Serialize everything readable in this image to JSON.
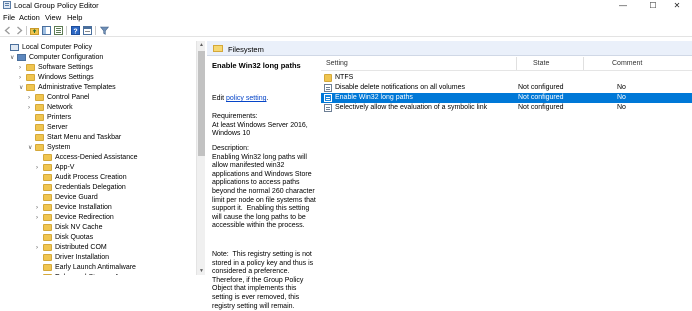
{
  "window": {
    "title": "Local Group Policy Editor",
    "minimize": "—",
    "maximize": "☐",
    "close": "✕"
  },
  "menu": [
    "File",
    "Action",
    "View",
    "Help"
  ],
  "toolbar": [
    "back-icon",
    "forward-icon",
    "folder-up-icon",
    "show-hide-tree-icon",
    "export-list-icon",
    "help-icon",
    "properties-icon",
    "filter-icon"
  ],
  "tree": [
    {
      "label": "Local Computer Policy",
      "level": 0,
      "expander": "",
      "icon": "computer-policy-icon"
    },
    {
      "label": "Computer Configuration",
      "level": 1,
      "expander": "∨",
      "icon": "computer-icon"
    },
    {
      "label": "Software Settings",
      "level": 2,
      "expander": "›",
      "icon": "folder-icon"
    },
    {
      "label": "Windows Settings",
      "level": 2,
      "expander": "›",
      "icon": "folder-icon"
    },
    {
      "label": "Administrative Templates",
      "level": 2,
      "expander": "∨",
      "icon": "folder-icon"
    },
    {
      "label": "Control Panel",
      "level": 3,
      "expander": "›",
      "icon": "folder-icon"
    },
    {
      "label": "Network",
      "level": 3,
      "expander": "›",
      "icon": "folder-icon"
    },
    {
      "label": "Printers",
      "level": 3,
      "expander": "",
      "icon": "folder-icon"
    },
    {
      "label": "Server",
      "level": 3,
      "expander": "",
      "icon": "folder-icon"
    },
    {
      "label": "Start Menu and Taskbar",
      "level": 3,
      "expander": "",
      "icon": "folder-icon"
    },
    {
      "label": "System",
      "level": 3,
      "expander": "∨",
      "icon": "folder-icon"
    },
    {
      "label": "Access-Denied Assistance",
      "level": 4,
      "expander": "",
      "icon": "folder-icon"
    },
    {
      "label": "App-V",
      "level": 4,
      "expander": "›",
      "icon": "folder-icon"
    },
    {
      "label": "Audit Process Creation",
      "level": 4,
      "expander": "",
      "icon": "folder-icon"
    },
    {
      "label": "Credentials Delegation",
      "level": 4,
      "expander": "",
      "icon": "folder-icon"
    },
    {
      "label": "Device Guard",
      "level": 4,
      "expander": "",
      "icon": "folder-icon"
    },
    {
      "label": "Device Installation",
      "level": 4,
      "expander": "›",
      "icon": "folder-icon"
    },
    {
      "label": "Device Redirection",
      "level": 4,
      "expander": "›",
      "icon": "folder-icon"
    },
    {
      "label": "Disk NV Cache",
      "level": 4,
      "expander": "",
      "icon": "folder-icon"
    },
    {
      "label": "Disk Quotas",
      "level": 4,
      "expander": "",
      "icon": "folder-icon"
    },
    {
      "label": "Distributed COM",
      "level": 4,
      "expander": "›",
      "icon": "folder-icon"
    },
    {
      "label": "Driver Installation",
      "level": 4,
      "expander": "",
      "icon": "folder-icon"
    },
    {
      "label": "Early Launch Antimalware",
      "level": 4,
      "expander": "",
      "icon": "folder-icon"
    },
    {
      "label": "Enhanced Storage Access",
      "level": 4,
      "expander": "",
      "icon": "folder-icon"
    }
  ],
  "scrollbar": {
    "up": "▲",
    "down": "▼"
  },
  "header": {
    "title": "Filesystem"
  },
  "extended": {
    "title": "Enable Win32 long paths",
    "edit_prefix": "Edit ",
    "edit_link": "policy setting",
    "edit_suffix": ".",
    "requirements": "Requirements:\nAt least Windows Server 2016, Windows 10",
    "description": "Description:\nEnabling Win32 long paths will allow manifested win32 applications and Windows Store applications to access paths beyond the normal 260 character limit per node on file systems that support it.  Enabling this setting will cause the long paths to be accessible within the process.",
    "note": "Note:  This registry setting is not stored in a policy key and thus is considered a preference.  Therefore, if the Group Policy Object that implements this setting is ever removed, this registry setting will remain."
  },
  "columns": {
    "setting": "Setting",
    "state": "State",
    "comment": "Comment"
  },
  "rows": [
    {
      "setting": "NTFS",
      "state": "",
      "comment": "",
      "icon": "folder-icon",
      "selected": false
    },
    {
      "setting": "Disable delete notifications on all volumes",
      "state": "Not configured",
      "comment": "No",
      "icon": "setting-icon",
      "selected": false
    },
    {
      "setting": "Enable Win32 long paths",
      "state": "Not configured",
      "comment": "No",
      "icon": "setting-icon",
      "selected": true
    },
    {
      "setting": "Selectively allow the evaluation of a symbolic link",
      "state": "Not configured",
      "comment": "No",
      "icon": "setting-icon",
      "selected": false
    }
  ],
  "colors": {
    "selection": "#0078d7",
    "header_bg": "#eaf0fa",
    "folder": "#f0c550",
    "link": "#0645c8"
  }
}
